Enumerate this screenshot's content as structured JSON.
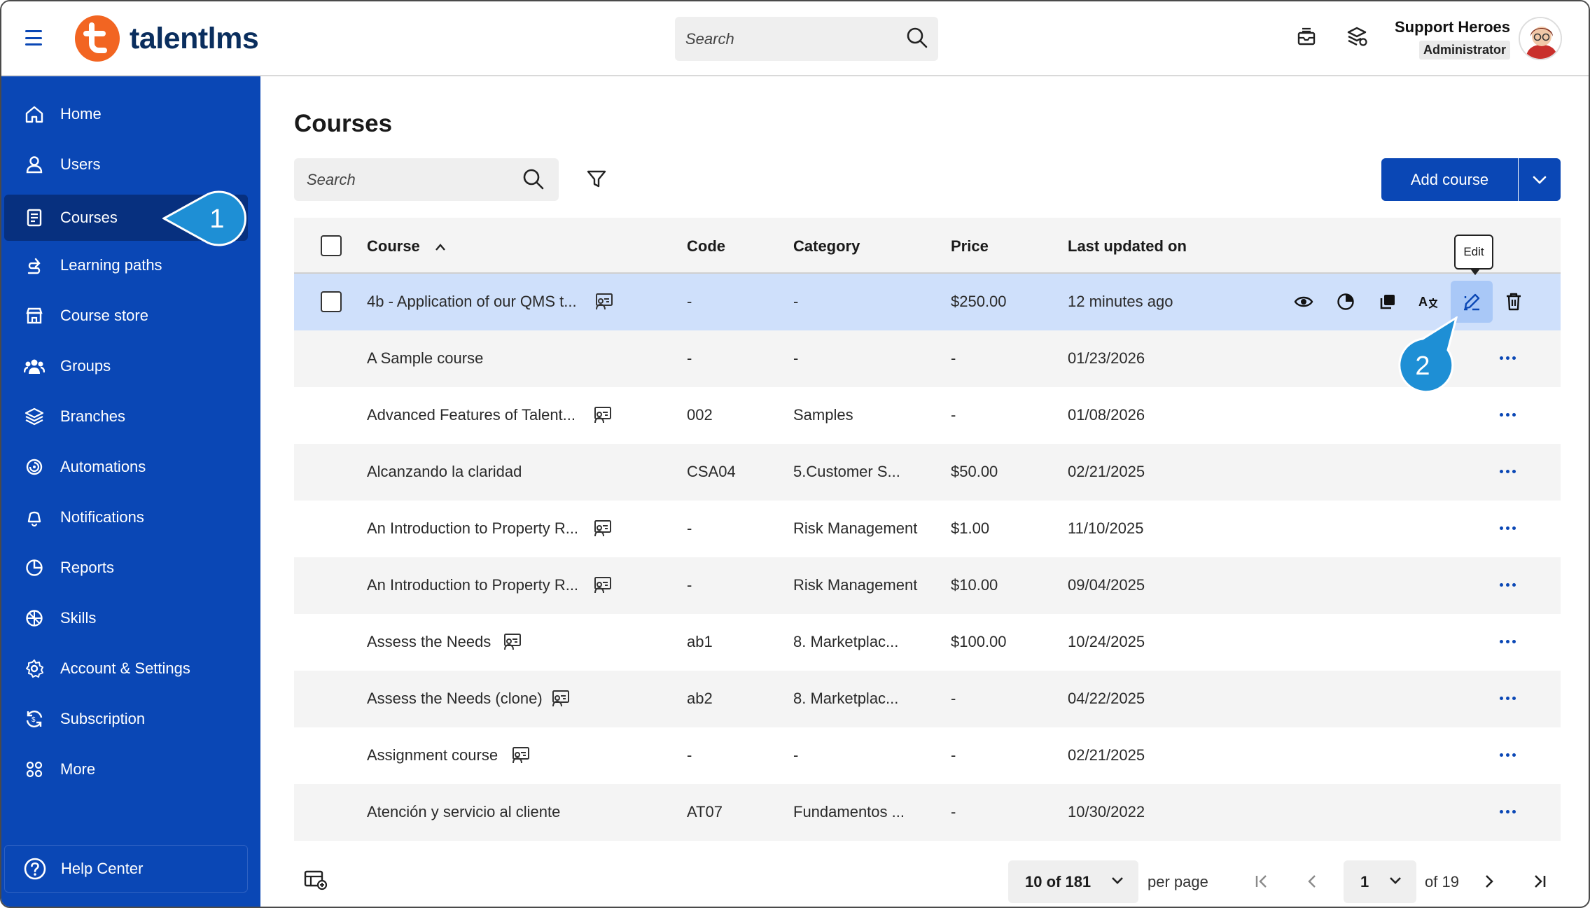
{
  "header": {
    "logo_text": "talentlms",
    "search_placeholder": "Search",
    "user_name": "Support Heroes",
    "user_role": "Administrator"
  },
  "sidebar": {
    "items": [
      {
        "label": "Home",
        "icon": "home-icon"
      },
      {
        "label": "Users",
        "icon": "user-icon"
      },
      {
        "label": "Courses",
        "icon": "courses-icon",
        "active": true
      },
      {
        "label": "Learning paths",
        "icon": "learning-paths-icon"
      },
      {
        "label": "Course store",
        "icon": "store-icon"
      },
      {
        "label": "Groups",
        "icon": "groups-icon"
      },
      {
        "label": "Branches",
        "icon": "branches-icon"
      },
      {
        "label": "Automations",
        "icon": "automations-icon"
      },
      {
        "label": "Notifications",
        "icon": "notifications-icon"
      },
      {
        "label": "Reports",
        "icon": "reports-icon"
      },
      {
        "label": "Skills",
        "icon": "skills-icon"
      },
      {
        "label": "Account & Settings",
        "icon": "settings-icon"
      },
      {
        "label": "Subscription",
        "icon": "subscription-icon"
      },
      {
        "label": "More",
        "icon": "more-icon"
      }
    ],
    "help_label": "Help Center"
  },
  "callouts": {
    "step1": "1",
    "step2": "2"
  },
  "main": {
    "title": "Courses",
    "search_placeholder": "Search",
    "add_course_label": "Add course",
    "tooltip": "Edit"
  },
  "table": {
    "columns": {
      "course": "Course",
      "code": "Code",
      "category": "Category",
      "price": "Price",
      "updated": "Last updated on"
    },
    "rows": [
      {
        "course": "4b - Application of our QMS t...",
        "code": "-",
        "category": "-",
        "price": "$250.00",
        "updated": "12 minutes ago",
        "instructor_led": true
      },
      {
        "course": "A Sample course",
        "code": "-",
        "category": "-",
        "price": "-",
        "updated": "01/23/2026",
        "instructor_led": false
      },
      {
        "course": "Advanced Features of Talent...",
        "code": "002",
        "category": "Samples",
        "price": "-",
        "updated": "01/08/2026",
        "instructor_led": true
      },
      {
        "course": "Alcanzando la claridad",
        "code": "CSA04",
        "category": "5.Customer S...",
        "price": "$50.00",
        "updated": "02/21/2025",
        "instructor_led": false
      },
      {
        "course": "An Introduction to Property R...",
        "code": "-",
        "category": "Risk Management",
        "price": "$1.00",
        "updated": "11/10/2025",
        "instructor_led": true
      },
      {
        "course": "An Introduction to Property R...",
        "code": "-",
        "category": "Risk Management",
        "price": "$10.00",
        "updated": "09/04/2025",
        "instructor_led": true
      },
      {
        "course": "Assess the Needs",
        "code": "ab1",
        "category": "8. Marketplac...",
        "price": "$100.00",
        "updated": "10/24/2025",
        "instructor_led": true
      },
      {
        "course": "Assess the Needs (clone)",
        "code": "ab2",
        "category": "8. Marketplac...",
        "price": "-",
        "updated": "04/22/2025",
        "instructor_led": true
      },
      {
        "course": "Assignment course",
        "code": "-",
        "category": "-",
        "price": "-",
        "updated": "02/21/2025",
        "instructor_led": true
      },
      {
        "course": "Atención y servicio al cliente",
        "code": "AT07",
        "category": "Fundamentos ...",
        "price": "-",
        "updated": "10/30/2022",
        "instructor_led": false
      }
    ]
  },
  "pagination": {
    "per_page_value": "10 of 181",
    "per_page_label": "per page",
    "page": "1",
    "of_pages": "of 19"
  },
  "colors": {
    "brand_blue": "#0a47b5",
    "brand_orange": "#f26522",
    "selected_row": "#cfe0fb",
    "callout": "#1e8fd5"
  }
}
